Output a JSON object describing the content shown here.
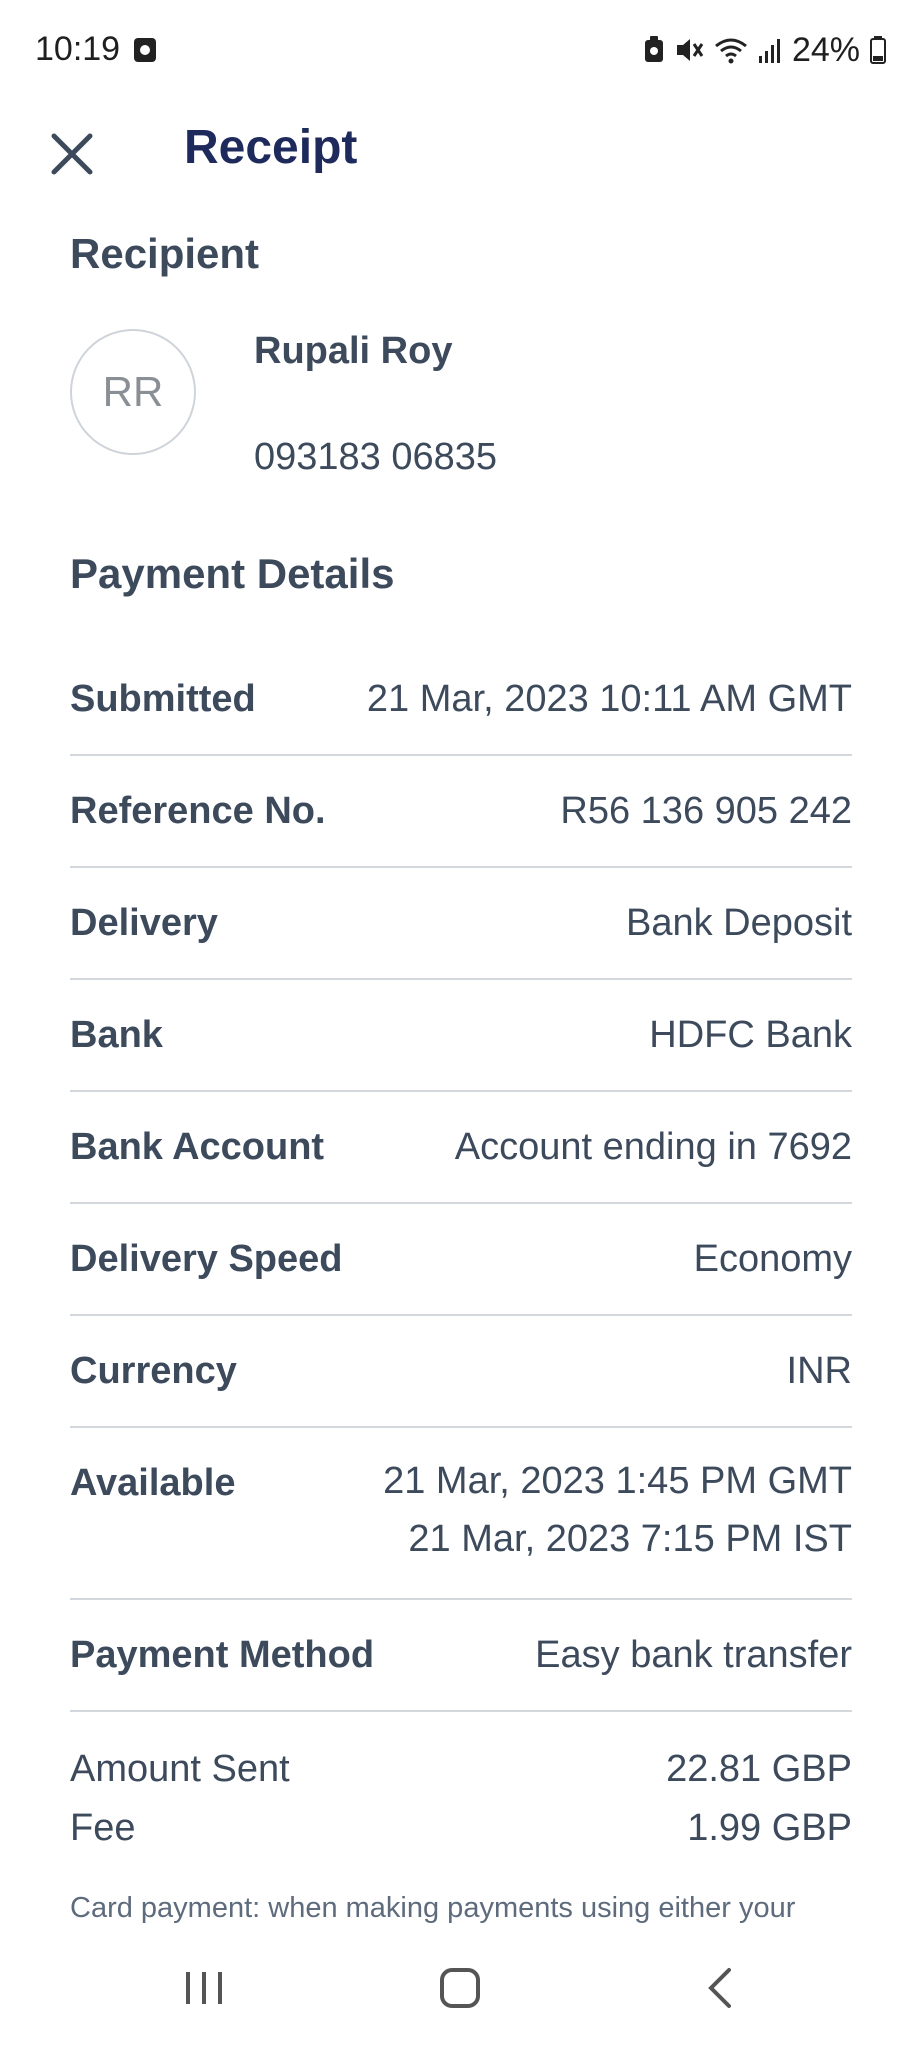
{
  "status_bar": {
    "time": "10:19",
    "battery": "24%",
    "icons": [
      "app-notification-icon",
      "lock-battery-icon",
      "mute-icon",
      "wifi-icon",
      "signal-icon",
      "battery-icon"
    ]
  },
  "header": {
    "title": "Receipt",
    "close_icon": "close-icon"
  },
  "recipient": {
    "section_title": "Recipient",
    "initials": "RR",
    "name": "Rupali Roy",
    "phone": "093183 06835"
  },
  "payment_details": {
    "section_title": "Payment Details",
    "rows": [
      {
        "label": "Submitted",
        "value": "21 Mar, 2023 10:11 AM GMT"
      },
      {
        "label": "Reference No.",
        "value": "R56 136 905 242"
      },
      {
        "label": "Delivery",
        "value": "Bank Deposit"
      },
      {
        "label": "Bank",
        "value": "HDFC Bank"
      },
      {
        "label": "Bank Account",
        "value": "Account ending in 7692"
      },
      {
        "label": "Delivery Speed",
        "value": "Economy"
      },
      {
        "label": "Currency",
        "value": "INR"
      },
      {
        "label": "Available",
        "value_line1": "21 Mar, 2023 1:45 PM GMT",
        "value_line2": "21 Mar, 2023 7:15 PM IST"
      },
      {
        "label": "Payment Method",
        "value": "Easy bank transfer"
      }
    ]
  },
  "summary": {
    "amount_sent_label": "Amount Sent",
    "amount_sent_value": "22.81 GBP",
    "fee_label": "Fee",
    "fee_value": "1.99 GBP"
  },
  "card_note": "Card payment: when making payments using either your",
  "nav_bar": {
    "icons": [
      "recent-apps-icon",
      "home-icon",
      "back-icon"
    ]
  },
  "colors": {
    "title": "#1f2a5c",
    "text": "#3c4a5c",
    "divider": "#d3d8de"
  }
}
